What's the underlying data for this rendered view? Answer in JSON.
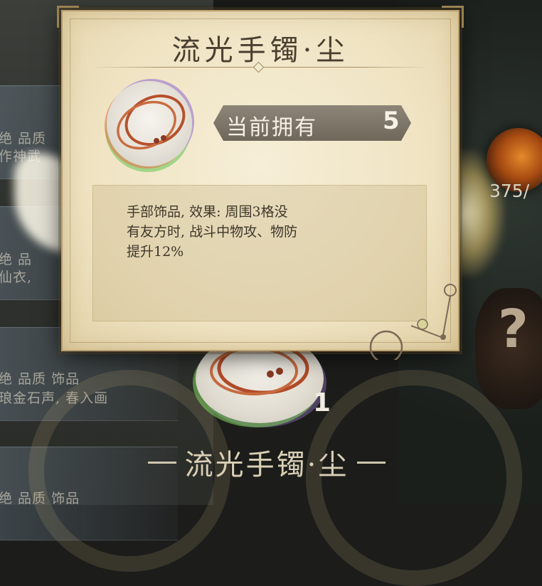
{
  "background": {
    "list_rows": [
      {
        "line1": "绝 品质",
        "line2": "作神武"
      },
      {
        "line1": "绝 品",
        "line2": "仙衣,"
      },
      {
        "line1": "绝 品质 饰品",
        "line2": "琅金石声, 春入画"
      },
      {
        "line1": "绝 品质 饰品",
        "line2": ""
      }
    ],
    "counter_text": "375/",
    "help_glyph": "?"
  },
  "popup": {
    "title": "流光手镯·尘",
    "icon": "bracelet-icon",
    "own_label": "当前拥有",
    "own_count": "5",
    "description": "手部饰品, 效果: 周围3格没\n有友方时, 战斗中物攻、物防\n提升12%"
  },
  "bottom": {
    "item_icon": "bracelet-icon",
    "count": "1",
    "title": "流光手镯·尘"
  },
  "colors": {
    "parchment": "#efe3c2",
    "banner": "#7d7568",
    "text_dark": "#4a4030",
    "glow": "#fff3c0"
  }
}
